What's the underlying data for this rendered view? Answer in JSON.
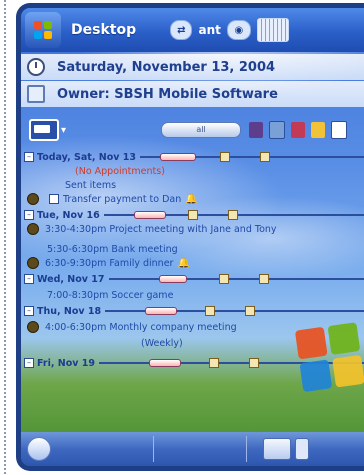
{
  "titlebar": {
    "title": "Desktop",
    "signal": "ant",
    "ime": "IIII"
  },
  "today": {
    "date": "Saturday, November 13, 2004",
    "owner": "Owner: SBSH Mobile Software"
  },
  "toolbar": {
    "slider_label": "all"
  },
  "calendar": {
    "days": [
      {
        "label": "Today, Sat, Nov 13"
      },
      {
        "label": "Tue, Nov 16"
      },
      {
        "label": "Wed, Nov 17"
      },
      {
        "label": "Thu, Nov 18"
      },
      {
        "label": "Fri, Nov 19"
      }
    ],
    "items": {
      "no_appt": "(No Appointments)",
      "sent_item": "Sent items",
      "task1": "Transfer payment to Dan",
      "event_tue1": "3:30-4:30pm Project meeting with Jane and Tony",
      "event_tue2": "5:30-6:30pm Bank meeting",
      "event_tue3": "6:30-9:30pm Family dinner",
      "event_wed1": "7:00-8:30pm Soccer game",
      "event_thu1": "4:00-6:30pm Monthly company meeting",
      "event_thu1_cont": "(Weekly)"
    }
  }
}
